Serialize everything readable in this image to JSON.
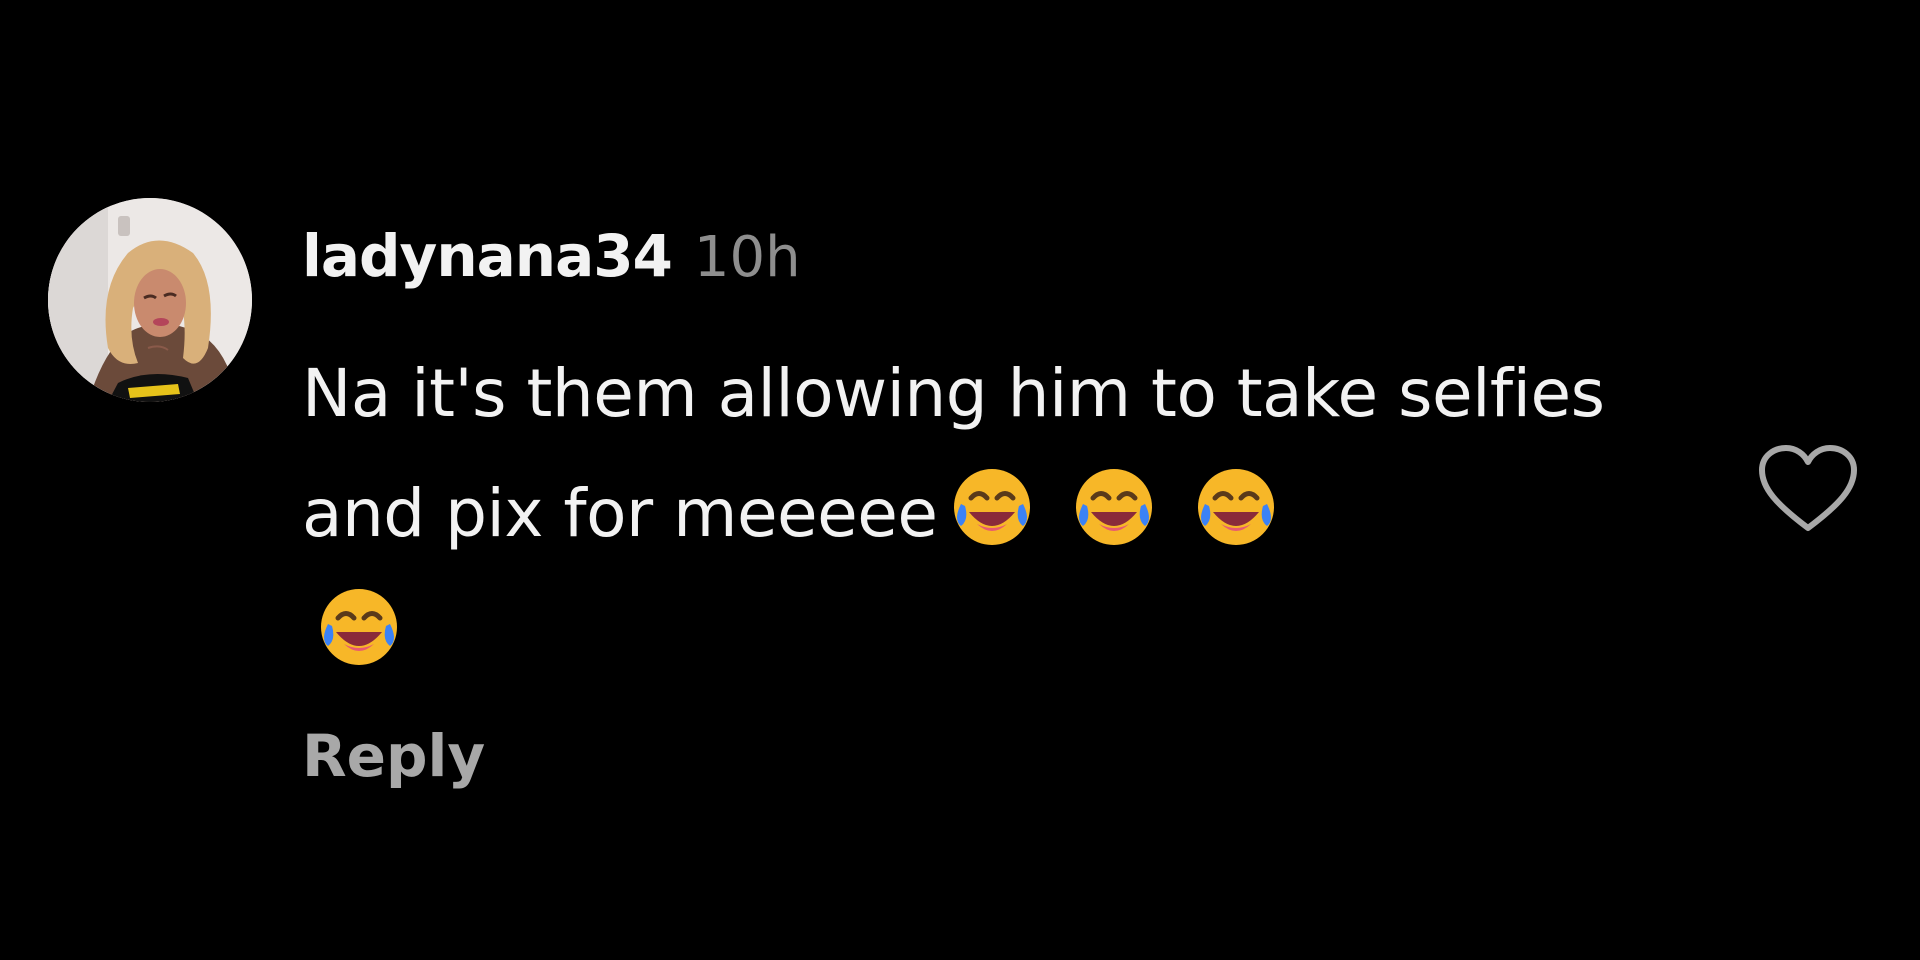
{
  "comment": {
    "username": "ladynana34",
    "timestamp": "10h",
    "text": "Na it's them allowing him to take selfies and pix for meeeee",
    "emojis": [
      "😂",
      "😂",
      "😂",
      "😂"
    ],
    "emoji_name": "face-with-tears-of-joy-icon",
    "reply_label": "Reply",
    "like_icon": "heart-outline-icon"
  },
  "colors": {
    "background": "#000000",
    "text": "#f2f2f2",
    "muted": "#8e8e8e",
    "reply": "#a8a8a8",
    "emoji_face": "#f7b728",
    "emoji_tears": "#3b82f6"
  }
}
